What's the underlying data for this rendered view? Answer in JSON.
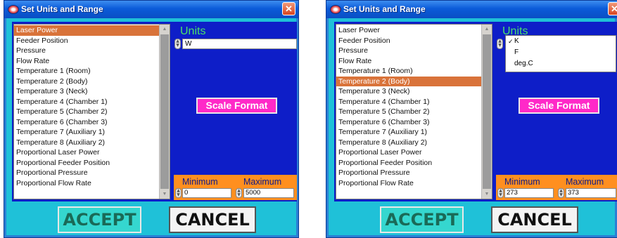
{
  "colors": {
    "window_border": "#2a7fd4",
    "client_bg": "#1fc1d8",
    "panel_bg": "#0e1ec8",
    "selection": "#d9733a",
    "units_label": "#49e06b",
    "scale_button": "#ff29c8",
    "range_box": "#ff8f1f"
  },
  "dialog_left": {
    "title": "Set Units and Range",
    "close_glyph": "✕",
    "channels": [
      {
        "label": "Laser Power",
        "selected": true
      },
      {
        "label": "Feeder Position",
        "selected": false
      },
      {
        "label": "Pressure",
        "selected": false
      },
      {
        "label": "Flow Rate",
        "selected": false
      },
      {
        "label": "Temperature 1 (Room)",
        "selected": false
      },
      {
        "label": "Temperature 2 (Body)",
        "selected": false
      },
      {
        "label": "Temperature 3 (Neck)",
        "selected": false
      },
      {
        "label": "Temperature 4 (Chamber 1)",
        "selected": false
      },
      {
        "label": "Temperature 5 (Chamber 2)",
        "selected": false
      },
      {
        "label": "Temperature 6 (Chamber 3)",
        "selected": false
      },
      {
        "label": "Temperature 7 (Auxiliary 1)",
        "selected": false
      },
      {
        "label": "Temperature 8 (Auxiliary 2)",
        "selected": false
      },
      {
        "label": "Proportional Laser Power",
        "selected": false
      },
      {
        "label": "Proportional Feeder Position",
        "selected": false
      },
      {
        "label": "Proportional Pressure",
        "selected": false
      },
      {
        "label": "Proportional Flow Rate",
        "selected": false
      }
    ],
    "units_label": "Units",
    "units_value": "W",
    "scale_format_label": "Scale Format",
    "minimum_label": "Minimum",
    "maximum_label": "Maximum",
    "minimum_value": "0",
    "maximum_value": "5000",
    "accept_label": "ACCEPT",
    "cancel_label": "CANCEL"
  },
  "dialog_right": {
    "title": "Set Units and Range",
    "close_glyph": "✕",
    "channels": [
      {
        "label": "Laser Power",
        "selected": false
      },
      {
        "label": "Feeder Position",
        "selected": false
      },
      {
        "label": "Pressure",
        "selected": false
      },
      {
        "label": "Flow Rate",
        "selected": false
      },
      {
        "label": "Temperature 1 (Room)",
        "selected": false
      },
      {
        "label": "Temperature 2 (Body)",
        "selected": true
      },
      {
        "label": "Temperature 3 (Neck)",
        "selected": false
      },
      {
        "label": "Temperature 4 (Chamber 1)",
        "selected": false
      },
      {
        "label": "Temperature 5 (Chamber 2)",
        "selected": false
      },
      {
        "label": "Temperature 6 (Chamber 3)",
        "selected": false
      },
      {
        "label": "Temperature 7 (Auxiliary 1)",
        "selected": false
      },
      {
        "label": "Temperature 8 (Auxiliary 2)",
        "selected": false
      },
      {
        "label": "Proportional Laser Power",
        "selected": false
      },
      {
        "label": "Proportional Feeder Position",
        "selected": false
      },
      {
        "label": "Proportional Pressure",
        "selected": false
      },
      {
        "label": "Proportional Flow Rate",
        "selected": false
      }
    ],
    "units_label": "Units",
    "units_options": [
      {
        "label": "K",
        "checked": true
      },
      {
        "label": "F",
        "checked": false
      },
      {
        "label": "deg.C",
        "checked": false
      }
    ],
    "check_glyph": "✓",
    "scale_format_label": "Scale Format",
    "minimum_label": "Minimum",
    "maximum_label": "Maximum",
    "minimum_value": "273",
    "maximum_value": "373",
    "accept_label": "ACCEPT",
    "cancel_label": "CANCEL"
  }
}
